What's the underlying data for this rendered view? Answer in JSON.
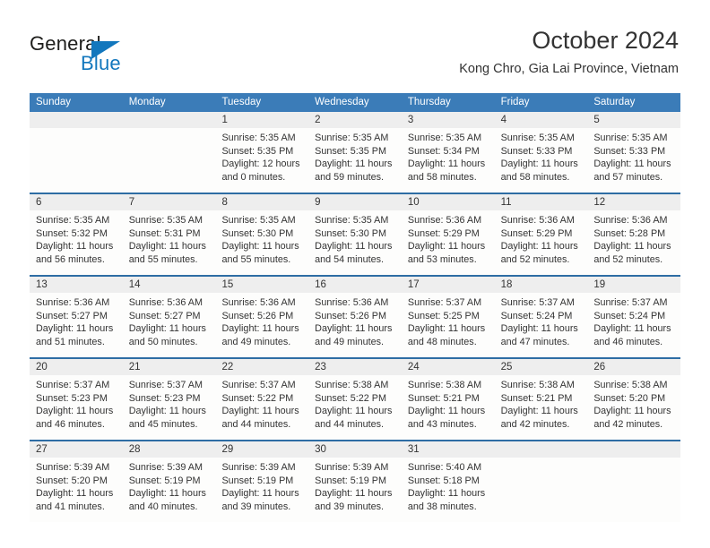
{
  "brand": {
    "name_part1": "General",
    "name_part2": "Blue",
    "accent_color": "#1277bd"
  },
  "header": {
    "title": "October 2024",
    "subtitle": "Kong Chro, Gia Lai Province, Vietnam"
  },
  "calendar": {
    "header_color": "#3b7cb8",
    "weekdays": [
      "Sunday",
      "Monday",
      "Tuesday",
      "Wednesday",
      "Thursday",
      "Friday",
      "Saturday"
    ],
    "weeks": [
      [
        {
          "day": "",
          "sunrise": "",
          "sunset": "",
          "daylight1": "",
          "daylight2": ""
        },
        {
          "day": "",
          "sunrise": "",
          "sunset": "",
          "daylight1": "",
          "daylight2": ""
        },
        {
          "day": "1",
          "sunrise": "Sunrise: 5:35 AM",
          "sunset": "Sunset: 5:35 PM",
          "daylight1": "Daylight: 12 hours",
          "daylight2": "and 0 minutes."
        },
        {
          "day": "2",
          "sunrise": "Sunrise: 5:35 AM",
          "sunset": "Sunset: 5:35 PM",
          "daylight1": "Daylight: 11 hours",
          "daylight2": "and 59 minutes."
        },
        {
          "day": "3",
          "sunrise": "Sunrise: 5:35 AM",
          "sunset": "Sunset: 5:34 PM",
          "daylight1": "Daylight: 11 hours",
          "daylight2": "and 58 minutes."
        },
        {
          "day": "4",
          "sunrise": "Sunrise: 5:35 AM",
          "sunset": "Sunset: 5:33 PM",
          "daylight1": "Daylight: 11 hours",
          "daylight2": "and 58 minutes."
        },
        {
          "day": "5",
          "sunrise": "Sunrise: 5:35 AM",
          "sunset": "Sunset: 5:33 PM",
          "daylight1": "Daylight: 11 hours",
          "daylight2": "and 57 minutes."
        }
      ],
      [
        {
          "day": "6",
          "sunrise": "Sunrise: 5:35 AM",
          "sunset": "Sunset: 5:32 PM",
          "daylight1": "Daylight: 11 hours",
          "daylight2": "and 56 minutes."
        },
        {
          "day": "7",
          "sunrise": "Sunrise: 5:35 AM",
          "sunset": "Sunset: 5:31 PM",
          "daylight1": "Daylight: 11 hours",
          "daylight2": "and 55 minutes."
        },
        {
          "day": "8",
          "sunrise": "Sunrise: 5:35 AM",
          "sunset": "Sunset: 5:30 PM",
          "daylight1": "Daylight: 11 hours",
          "daylight2": "and 55 minutes."
        },
        {
          "day": "9",
          "sunrise": "Sunrise: 5:35 AM",
          "sunset": "Sunset: 5:30 PM",
          "daylight1": "Daylight: 11 hours",
          "daylight2": "and 54 minutes."
        },
        {
          "day": "10",
          "sunrise": "Sunrise: 5:36 AM",
          "sunset": "Sunset: 5:29 PM",
          "daylight1": "Daylight: 11 hours",
          "daylight2": "and 53 minutes."
        },
        {
          "day": "11",
          "sunrise": "Sunrise: 5:36 AM",
          "sunset": "Sunset: 5:29 PM",
          "daylight1": "Daylight: 11 hours",
          "daylight2": "and 52 minutes."
        },
        {
          "day": "12",
          "sunrise": "Sunrise: 5:36 AM",
          "sunset": "Sunset: 5:28 PM",
          "daylight1": "Daylight: 11 hours",
          "daylight2": "and 52 minutes."
        }
      ],
      [
        {
          "day": "13",
          "sunrise": "Sunrise: 5:36 AM",
          "sunset": "Sunset: 5:27 PM",
          "daylight1": "Daylight: 11 hours",
          "daylight2": "and 51 minutes."
        },
        {
          "day": "14",
          "sunrise": "Sunrise: 5:36 AM",
          "sunset": "Sunset: 5:27 PM",
          "daylight1": "Daylight: 11 hours",
          "daylight2": "and 50 minutes."
        },
        {
          "day": "15",
          "sunrise": "Sunrise: 5:36 AM",
          "sunset": "Sunset: 5:26 PM",
          "daylight1": "Daylight: 11 hours",
          "daylight2": "and 49 minutes."
        },
        {
          "day": "16",
          "sunrise": "Sunrise: 5:36 AM",
          "sunset": "Sunset: 5:26 PM",
          "daylight1": "Daylight: 11 hours",
          "daylight2": "and 49 minutes."
        },
        {
          "day": "17",
          "sunrise": "Sunrise: 5:37 AM",
          "sunset": "Sunset: 5:25 PM",
          "daylight1": "Daylight: 11 hours",
          "daylight2": "and 48 minutes."
        },
        {
          "day": "18",
          "sunrise": "Sunrise: 5:37 AM",
          "sunset": "Sunset: 5:24 PM",
          "daylight1": "Daylight: 11 hours",
          "daylight2": "and 47 minutes."
        },
        {
          "day": "19",
          "sunrise": "Sunrise: 5:37 AM",
          "sunset": "Sunset: 5:24 PM",
          "daylight1": "Daylight: 11 hours",
          "daylight2": "and 46 minutes."
        }
      ],
      [
        {
          "day": "20",
          "sunrise": "Sunrise: 5:37 AM",
          "sunset": "Sunset: 5:23 PM",
          "daylight1": "Daylight: 11 hours",
          "daylight2": "and 46 minutes."
        },
        {
          "day": "21",
          "sunrise": "Sunrise: 5:37 AM",
          "sunset": "Sunset: 5:23 PM",
          "daylight1": "Daylight: 11 hours",
          "daylight2": "and 45 minutes."
        },
        {
          "day": "22",
          "sunrise": "Sunrise: 5:37 AM",
          "sunset": "Sunset: 5:22 PM",
          "daylight1": "Daylight: 11 hours",
          "daylight2": "and 44 minutes."
        },
        {
          "day": "23",
          "sunrise": "Sunrise: 5:38 AM",
          "sunset": "Sunset: 5:22 PM",
          "daylight1": "Daylight: 11 hours",
          "daylight2": "and 44 minutes."
        },
        {
          "day": "24",
          "sunrise": "Sunrise: 5:38 AM",
          "sunset": "Sunset: 5:21 PM",
          "daylight1": "Daylight: 11 hours",
          "daylight2": "and 43 minutes."
        },
        {
          "day": "25",
          "sunrise": "Sunrise: 5:38 AM",
          "sunset": "Sunset: 5:21 PM",
          "daylight1": "Daylight: 11 hours",
          "daylight2": "and 42 minutes."
        },
        {
          "day": "26",
          "sunrise": "Sunrise: 5:38 AM",
          "sunset": "Sunset: 5:20 PM",
          "daylight1": "Daylight: 11 hours",
          "daylight2": "and 42 minutes."
        }
      ],
      [
        {
          "day": "27",
          "sunrise": "Sunrise: 5:39 AM",
          "sunset": "Sunset: 5:20 PM",
          "daylight1": "Daylight: 11 hours",
          "daylight2": "and 41 minutes."
        },
        {
          "day": "28",
          "sunrise": "Sunrise: 5:39 AM",
          "sunset": "Sunset: 5:19 PM",
          "daylight1": "Daylight: 11 hours",
          "daylight2": "and 40 minutes."
        },
        {
          "day": "29",
          "sunrise": "Sunrise: 5:39 AM",
          "sunset": "Sunset: 5:19 PM",
          "daylight1": "Daylight: 11 hours",
          "daylight2": "and 39 minutes."
        },
        {
          "day": "30",
          "sunrise": "Sunrise: 5:39 AM",
          "sunset": "Sunset: 5:19 PM",
          "daylight1": "Daylight: 11 hours",
          "daylight2": "and 39 minutes."
        },
        {
          "day": "31",
          "sunrise": "Sunrise: 5:40 AM",
          "sunset": "Sunset: 5:18 PM",
          "daylight1": "Daylight: 11 hours",
          "daylight2": "and 38 minutes."
        },
        {
          "day": "",
          "sunrise": "",
          "sunset": "",
          "daylight1": "",
          "daylight2": ""
        },
        {
          "day": "",
          "sunrise": "",
          "sunset": "",
          "daylight1": "",
          "daylight2": ""
        }
      ]
    ]
  }
}
